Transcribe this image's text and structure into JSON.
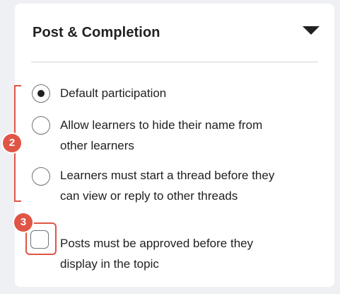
{
  "panel": {
    "title": "Post & Completion",
    "collapse_icon": "caret-down-icon"
  },
  "participation": {
    "options": [
      {
        "label_line1": "Default participation",
        "label_line2": "",
        "checked": true
      },
      {
        "label_line1": "Allow learners to hide their name from",
        "label_line2": "other learners",
        "checked": false
      },
      {
        "label_line1": "Learners must start a thread before they",
        "label_line2": "can view or reply to other threads",
        "checked": false
      }
    ]
  },
  "approval": {
    "label_line1": "Posts must be approved before they",
    "label_line2": "display in the topic",
    "checked": false
  },
  "annotations": {
    "callout_2": "2",
    "callout_3": "3",
    "accent_color": "#e05545"
  }
}
